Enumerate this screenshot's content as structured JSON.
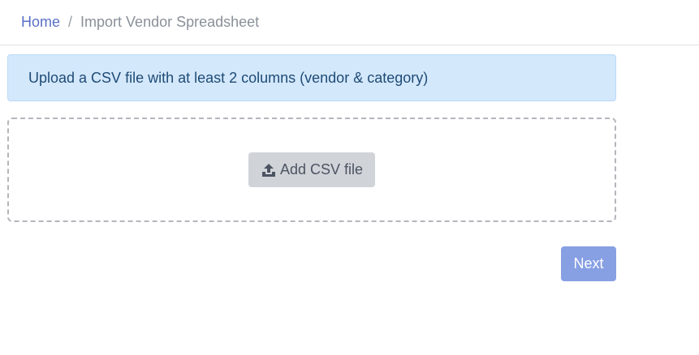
{
  "breadcrumb": {
    "home_label": "Home",
    "separator": "/",
    "current_label": "Import Vendor Spreadsheet"
  },
  "alert": {
    "message": "Upload a CSV file with at least 2 columns (vendor & category)"
  },
  "dropzone": {
    "add_button_label": "Add CSV file",
    "add_button_icon": "upload-icon"
  },
  "footer": {
    "next_label": "Next"
  },
  "colors": {
    "link": "#5a6fc7",
    "alert_bg": "#d4e8fb",
    "alert_text": "#1e4b76",
    "next_button": "#879fe3",
    "add_button": "#d0d3d8"
  }
}
